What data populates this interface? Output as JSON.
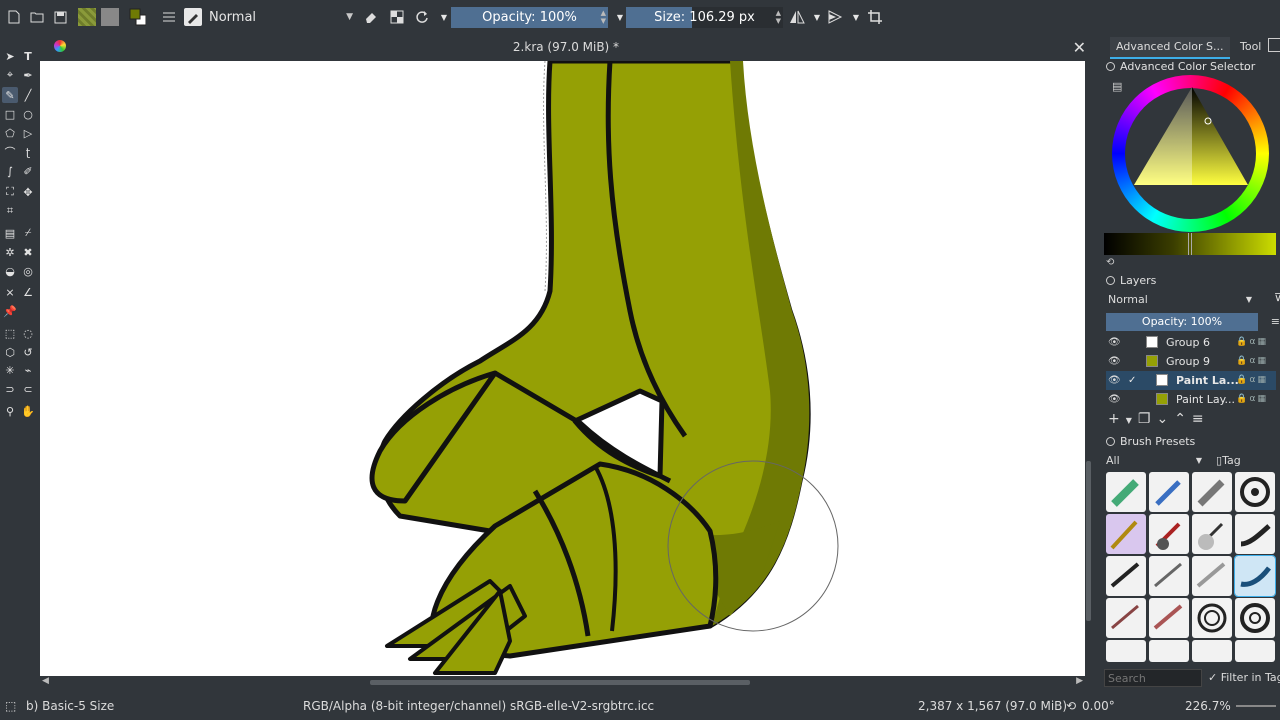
{
  "toolbar": {
    "blend_mode": "Normal",
    "opacity_label": "Opacity: 100%",
    "opacity_fraction": 1.0,
    "size_label": "Size: 106.29 px",
    "size_fraction": 0.42
  },
  "document": {
    "title": "2.kra (97.0 MiB) *"
  },
  "dock": {
    "tabs": [
      "Advanced Color S...",
      "Tool ..."
    ],
    "color_selector_title": "Advanced Color Selector",
    "layers": {
      "title": "Layers",
      "blend_mode": "Normal",
      "opacity_label": "Opacity:  100%",
      "rows": [
        {
          "name": "Group 6"
        },
        {
          "name": "Group 9"
        },
        {
          "name": "Paint La..."
        },
        {
          "name": "Paint Lay..."
        }
      ]
    },
    "brush_presets": {
      "title": "Brush Presets",
      "filter": "All",
      "tag_label": "Tag",
      "search_placeholder": "Search",
      "filter_in_tag": "Filter in Tag"
    }
  },
  "statusbar": {
    "brush": "b) Basic-5 Size",
    "color_model": "RGB/Alpha (8-bit integer/channel)  sRGB-elle-V2-srgbtrc.icc",
    "dimensions": "2,387 x 1,567 (97.0 MiB)",
    "rotation": "0.00°",
    "zoom": "226.7%"
  },
  "colors": {
    "accent": "#3daee9",
    "ui_bg": "#31363b",
    "dragon_fill": "#95a005",
    "dragon_shade": "#6f7a04"
  }
}
